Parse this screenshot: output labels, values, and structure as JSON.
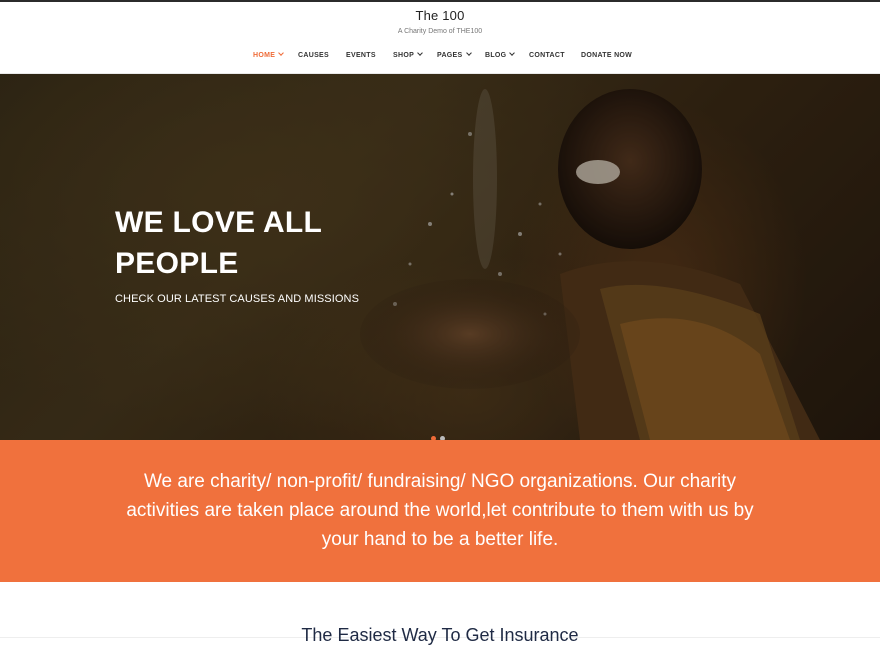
{
  "header": {
    "site_title": "The 100",
    "tagline": "A Charity Demo of THE100"
  },
  "nav": {
    "items": [
      {
        "label": "HOME",
        "active": true,
        "has_dropdown": true
      },
      {
        "label": "CAUSES",
        "active": false,
        "has_dropdown": false
      },
      {
        "label": "EVENTS",
        "active": false,
        "has_dropdown": false
      },
      {
        "label": "SHOP",
        "active": false,
        "has_dropdown": true
      },
      {
        "label": "PAGES",
        "active": false,
        "has_dropdown": true
      },
      {
        "label": "BLOG",
        "active": false,
        "has_dropdown": true
      },
      {
        "label": "CONTACT",
        "active": false,
        "has_dropdown": false
      },
      {
        "label": "DONATE NOW",
        "active": false,
        "has_dropdown": false
      }
    ]
  },
  "hero": {
    "title": "WE LOVE ALL PEOPLE",
    "subtitle": "CHECK OUR LATEST CAUSES AND MISSIONS",
    "slide_count": 2,
    "active_slide": 1
  },
  "band": {
    "text": "We are charity/ non-profit/ fundraising/ NGO organizations. Our charity activities are taken place around the world,let contribute to them with us by your hand to be a better life."
  },
  "section": {
    "title": "The Easiest Way To Get Insurance"
  },
  "colors": {
    "accent": "#ef6b38",
    "band": "#f0713d",
    "heading": "#1f2a44"
  }
}
